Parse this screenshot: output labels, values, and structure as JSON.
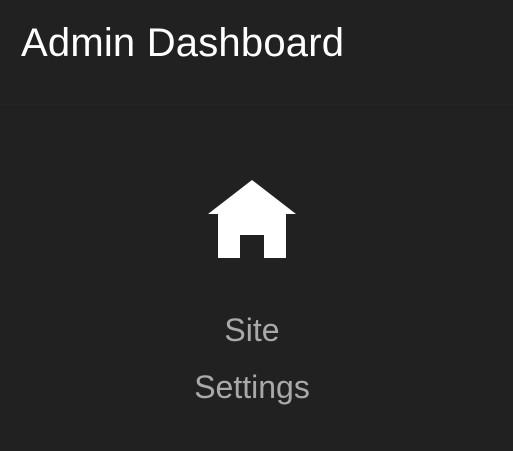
{
  "header": {
    "title": "Admin Dashboard"
  },
  "nav": {
    "items": [
      {
        "icon": "home-icon",
        "label_line1": "Site",
        "label_line2": "Settings"
      }
    ]
  },
  "colors": {
    "background": "#212121",
    "title_text": "#ffffff",
    "label_text": "#a9a9a9",
    "icon": "#ffffff"
  }
}
